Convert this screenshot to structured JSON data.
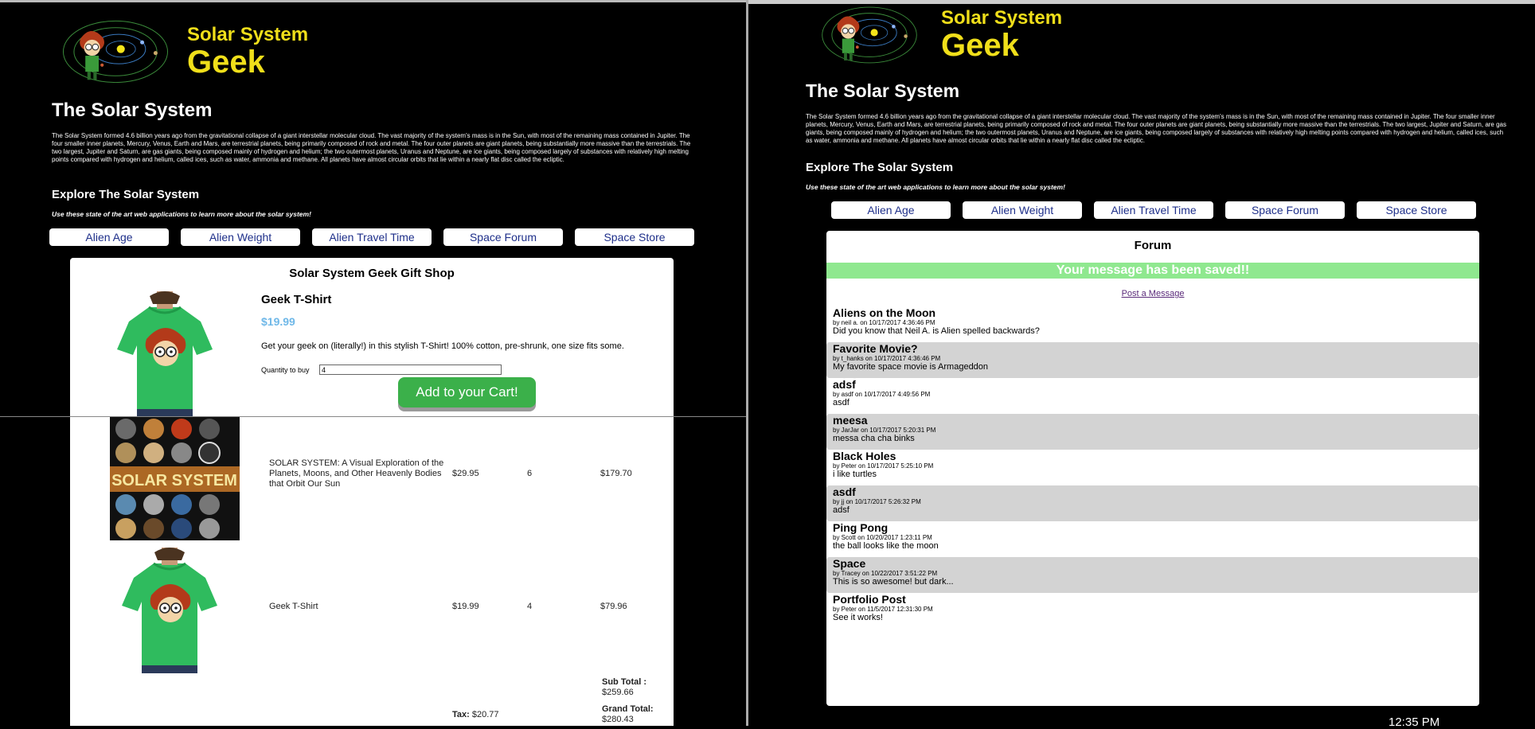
{
  "site": {
    "brand_line1": "Solar System",
    "brand_line2": "Geek",
    "title": "The Solar System",
    "intro": "The Solar System formed 4.6 billion years ago from the gravitational collapse of a giant interstellar molecular cloud. The vast majority of the system's mass is in the Sun, with most of the remaining mass contained in Jupiter. The four smaller inner planets, Mercury, Venus, Earth and Mars, are terrestrial planets, being primarily composed of rock and metal. The four outer planets are giant planets, being substantially more massive than the terrestrials. The two largest, Jupiter and Saturn, are gas giants, being composed mainly of hydrogen and helium; the two outermost planets, Uranus and Neptune, are ice giants, being composed largely of substances with relatively high melting points compared with hydrogen and helium, called ices, such as water, ammonia and methane. All planets have almost circular orbits that lie within a nearly flat disc called the ecliptic.",
    "explore_heading": "Explore The Solar System",
    "tagline": "Use these state of the art web applications to learn more about the solar system!",
    "nav": [
      "Alien Age",
      "Alien Weight",
      "Alien Travel Time",
      "Space Forum",
      "Space Store"
    ]
  },
  "shop": {
    "title": "Solar System Geek Gift Shop",
    "product_name": "Geek T-Shirt",
    "product_price": "$19.99",
    "product_desc": "Get your geek on (literally!) in this stylish T-Shirt! 100% cotton, pre-shrunk, one size fits some.",
    "qty_label": "Quantity to buy",
    "qty_value": "4",
    "add_button": "Add to your Cart!"
  },
  "cart": {
    "items": [
      {
        "desc": "SOLAR SYSTEM: A Visual Exploration of the Planets, Moons, and Other Heavenly Bodies that Orbit Our Sun",
        "price": "$29.95",
        "qty": "6",
        "total": "$179.70",
        "image": "book-cover"
      },
      {
        "desc": "Geek T-Shirt",
        "price": "$19.99",
        "qty": "4",
        "total": "$79.96",
        "image": "tshirt"
      }
    ],
    "subtotal_label": "Sub Total :",
    "subtotal": "$259.66",
    "tax_label": "Tax:",
    "tax": "$20.77",
    "grand_label": "Grand Total:",
    "grand_total": "$280.43",
    "book_cover_text": "SOLAR SYSTEM"
  },
  "forum": {
    "title": "Forum",
    "saved_message": "Your message has been saved!!",
    "post_link": "Post a Message",
    "posts": [
      {
        "title": "Aliens on the Moon",
        "meta": "by neil a. on 10/17/2017 4:36:46 PM",
        "body": "Did you know that Neil A. is Alien spelled backwards?"
      },
      {
        "title": "Favorite Movie?",
        "meta": "by t_hanks on 10/17/2017 4:36:46 PM",
        "body": "My favorite space movie is Armageddon"
      },
      {
        "title": "adsf",
        "meta": "by asdf on 10/17/2017 4:49:56 PM",
        "body": "asdf"
      },
      {
        "title": "meesa",
        "meta": "by JarJar on 10/17/2017 5:20:31 PM",
        "body": "messa cha cha binks"
      },
      {
        "title": "Black Holes",
        "meta": "by Peter on 10/17/2017 5:25:10 PM",
        "body": "i like turtles"
      },
      {
        "title": "asdf",
        "meta": "by jj on 10/17/2017 5:26:32 PM",
        "body": "adsf"
      },
      {
        "title": "Ping Pong",
        "meta": "by Scott on 10/20/2017 1:23:11 PM",
        "body": "the ball looks like the moon"
      },
      {
        "title": "Space",
        "meta": "by Tracey on 10/22/2017 3:51:22 PM",
        "body": "This is so awesome! but dark..."
      },
      {
        "title": "Portfolio Post",
        "meta": "by Peter on 11/5/2017 12:31:30 PM",
        "body": "See it works!"
      }
    ]
  },
  "taskbar": {
    "clock": "12:35 PM"
  },
  "colors": {
    "brand_yellow": "#f0df1a",
    "nav_text": "#1e2f8a",
    "price_blue": "#6fb8e8",
    "cart_green": "#3bb04a",
    "saved_green": "#8fe88f",
    "alt_row": "#d3d3d3"
  }
}
